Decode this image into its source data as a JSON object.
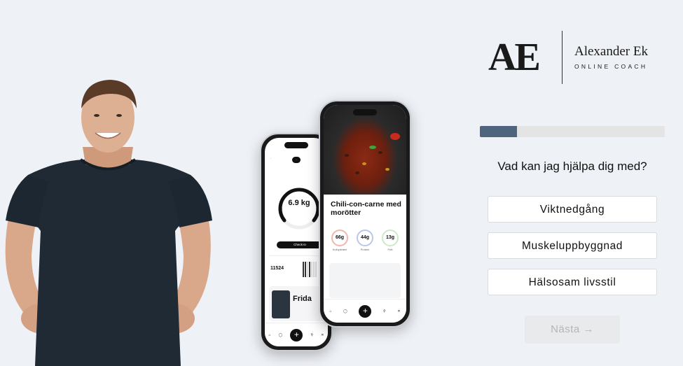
{
  "brand": {
    "monogram": "AE",
    "name": "Alexander Ek",
    "tagline": "ONLINE COACH"
  },
  "progress": {
    "value": 0.2
  },
  "question": {
    "text": "Vad kan jag hjälpa dig med?"
  },
  "options": [
    {
      "label": "Viktnedgång"
    },
    {
      "label": "Muskeluppbyggnad"
    },
    {
      "label": "Hälsosam livsstil"
    }
  ],
  "next_button": {
    "label": "Nästa →"
  },
  "app_preview": {
    "back_phone": {
      "weight_value": "6.9 kg",
      "checkin_label": "Check-in",
      "steps_value": "11524",
      "coach_name": "Frida"
    },
    "front_phone": {
      "recipe_title": "Chili-con-carne med morötter",
      "macros": [
        {
          "value": "66g",
          "label": "Kolhydrater"
        },
        {
          "value": "44g",
          "label": "Protein"
        },
        {
          "value": "13g",
          "label": "Fett"
        }
      ]
    }
  },
  "colors": {
    "background": "#eef1f6",
    "progress_fill": "#4f657d",
    "progress_track": "#e4e4e4"
  }
}
